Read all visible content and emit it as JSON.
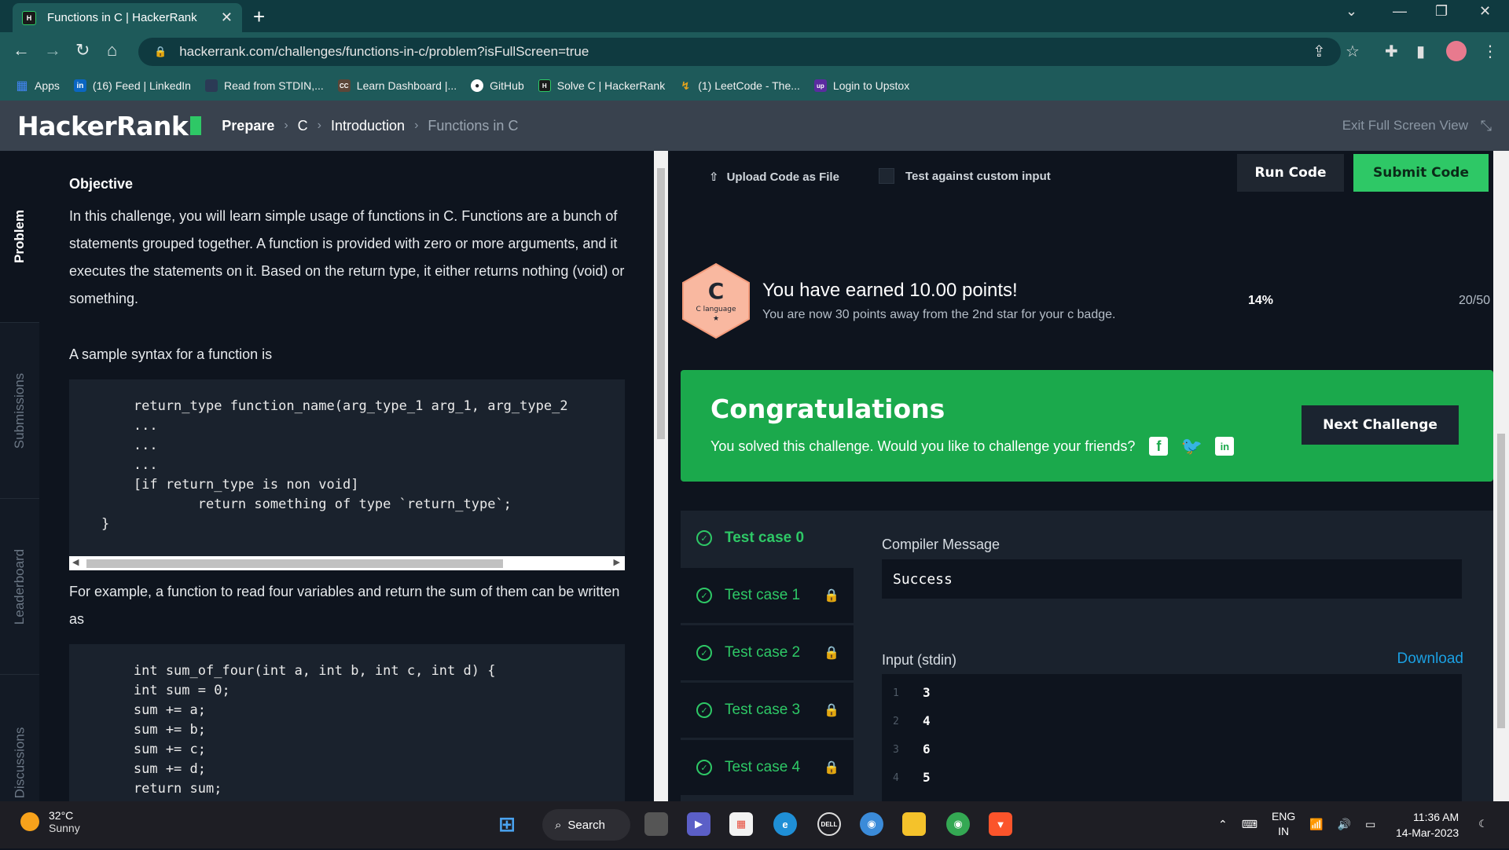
{
  "browser": {
    "tab_title": "Functions in C | HackerRank",
    "tab_close": "✕",
    "new_tab": "+",
    "url": "hackerrank.com/challenges/functions-in-c/problem?isFullScreen=true",
    "bookmarks": [
      {
        "label": "Apps",
        "icon": "apps-grid-icon",
        "color": "#4285f4",
        "glyph": "▦"
      },
      {
        "label": "(16) Feed | LinkedIn",
        "icon": "linkedin-icon",
        "color": "#0a66c2",
        "glyph": "in"
      },
      {
        "label": "Read from STDIN,...",
        "icon": "page-icon",
        "color": "#2b3a55",
        "glyph": "▯"
      },
      {
        "label": "Learn Dashboard |...",
        "icon": "codechef-icon",
        "color": "#5b4638",
        "glyph": "CC"
      },
      {
        "label": "GitHub",
        "icon": "github-icon",
        "color": "#24292e",
        "glyph": "●"
      },
      {
        "label": "Solve C | HackerRank",
        "icon": "hackerrank-icon",
        "color": "#1a1a1a",
        "glyph": "H"
      },
      {
        "label": "(1) LeetCode - The...",
        "icon": "leetcode-icon",
        "color": "#e7a41c",
        "glyph": "L"
      },
      {
        "label": "Login to Upstox",
        "icon": "upstox-icon",
        "color": "#5a2ca0",
        "glyph": "up"
      }
    ]
  },
  "header": {
    "logo": "HackerRank",
    "crumbs": [
      "Prepare",
      "C",
      "Introduction",
      "Functions in C"
    ],
    "exit_fullscreen": "Exit Full Screen View"
  },
  "rail": {
    "tabs": [
      "Problem",
      "Submissions",
      "Leaderboard",
      "Discussions"
    ]
  },
  "problem": {
    "objective_heading": "Objective",
    "intro": "In this challenge, you will learn simple usage of functions in C. Functions are a bunch of statements grouped together. A function is provided with zero or more arguments, and it executes the statements on it. Based on the return type, it either returns nothing (void) or something.",
    "syntax_intro": "A sample syntax for a function is",
    "code1": "        return_type function_name(arg_type_1 arg_1, arg_type_2\n        ...\n        ...\n        ...\n        [if return_type is non void]\n                return something of type `return_type`;\n    }",
    "example_intro": "For example, a function to read four variables and return the sum of them can be written as",
    "code2": "        int sum_of_four(int a, int b, int c, int d) {\n        int sum = 0;\n        sum += a;\n        sum += b;\n        sum += c;\n        sum += d;\n        return sum;"
  },
  "editor": {
    "upload_label": "Upload Code as File",
    "custom_input_label": "Test against custom input",
    "run_label": "Run Code",
    "submit_label": "Submit Code"
  },
  "score": {
    "badge_letter": "C",
    "badge_text": "C language",
    "earned": "You have earned 10.00 points!",
    "sub": "You are now 30 points away from the 2nd star for your c badge.",
    "progress_text": "14%",
    "points": "20/50"
  },
  "congrats": {
    "title": "Congratulations",
    "message": "You solved this challenge. Would you like to challenge your friends?",
    "next_label": "Next Challenge"
  },
  "results": {
    "test_cases": [
      {
        "label": "Test case 0",
        "locked": false
      },
      {
        "label": "Test case 1",
        "locked": true
      },
      {
        "label": "Test case 2",
        "locked": true
      },
      {
        "label": "Test case 3",
        "locked": true
      },
      {
        "label": "Test case 4",
        "locked": true
      }
    ],
    "compiler_label": "Compiler Message",
    "compiler_message": "Success",
    "input_label": "Input (stdin)",
    "download_label": "Download",
    "input_lines": [
      {
        "n": "1",
        "v": "3"
      },
      {
        "n": "2",
        "v": "4"
      },
      {
        "n": "3",
        "v": "6"
      },
      {
        "n": "4",
        "v": "5"
      }
    ]
  },
  "taskbar": {
    "temp": "32°C",
    "condition": "Sunny",
    "search": "Search",
    "lang1": "ENG",
    "lang2": "IN",
    "time": "11:36 AM",
    "date": "14-Mar-2023"
  },
  "colors": {
    "accent": "#2ec866",
    "congrats_bg": "#1ba94c",
    "link": "#1ba0e2"
  }
}
